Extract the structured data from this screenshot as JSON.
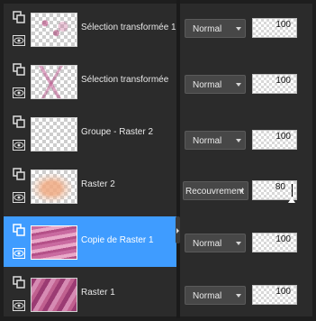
{
  "layers": [
    {
      "name": "Sélection transformée 1",
      "blend": "Normal",
      "opacity": "100",
      "selected": false,
      "thumb": "sel1"
    },
    {
      "name": "Sélection transformée",
      "blend": "Normal",
      "opacity": "100",
      "selected": false,
      "thumb": "sel2"
    },
    {
      "name": "Groupe - Raster 2",
      "blend": "Normal",
      "opacity": "100",
      "selected": false,
      "thumb": "empty"
    },
    {
      "name": "Raster 2",
      "blend": "Recouvrement",
      "opacity": "80",
      "selected": false,
      "thumb": "peach"
    },
    {
      "name": "Copie de Raster 1",
      "blend": "Normal",
      "opacity": "100",
      "selected": true,
      "thumb": "pink"
    },
    {
      "name": "Raster 1",
      "blend": "Normal",
      "opacity": "100",
      "selected": false,
      "thumb": "pink2"
    }
  ],
  "colors": {
    "selection": "#3f9cff",
    "panel": "#2b2b2b",
    "background": "#1e1e1e"
  },
  "icons": {
    "layer_toggle": "layer-visibility-toggle-icon",
    "eye": "eye-icon"
  }
}
